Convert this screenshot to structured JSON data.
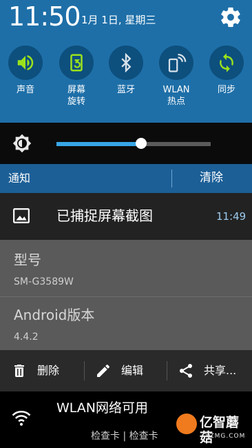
{
  "status": {
    "time": "11:50",
    "date": "1月 1日, 星期三",
    "settings_icon": "gear-icon"
  },
  "toggles": [
    {
      "label": "声音",
      "icon": "sound-icon",
      "active": true
    },
    {
      "label": "屏幕\n旋转",
      "icon": "screen-rotation-icon",
      "active": true
    },
    {
      "label": "蓝牙",
      "icon": "bluetooth-icon",
      "active": false
    },
    {
      "label": "WLAN\n热点",
      "icon": "wlan-hotspot-icon",
      "active": false
    },
    {
      "label": "同步",
      "icon": "sync-icon",
      "active": true
    }
  ],
  "brightness": {
    "icon": "brightness-auto-icon",
    "level": 0.55
  },
  "notifications_header": {
    "title": "通知",
    "clear_label": "清除"
  },
  "screenshot_notification": {
    "icon": "image-icon",
    "title": "已捕捉屏幕截图",
    "time": "11:49",
    "preview": {
      "model_label": "型号",
      "model_value": "SM-G3589W",
      "android_label": "Android版本",
      "android_value": "4.4.2"
    },
    "actions": [
      {
        "label": "删除",
        "icon": "trash-icon"
      },
      {
        "label": "编辑",
        "icon": "pencil-icon"
      },
      {
        "label": "共享...",
        "icon": "share-icon"
      }
    ]
  },
  "wlan_notification": {
    "icon": "wifi-icon",
    "title": "WLAN网络可用",
    "subtitle": "检查卡 | 检查卡"
  },
  "watermark": {
    "name": "亿智蘑菇",
    "url": "YZMG.COM"
  },
  "colors": {
    "panel_blue": "#1e6fa8",
    "active_green": "#9be21c",
    "accent_blue": "#38a6e6"
  }
}
